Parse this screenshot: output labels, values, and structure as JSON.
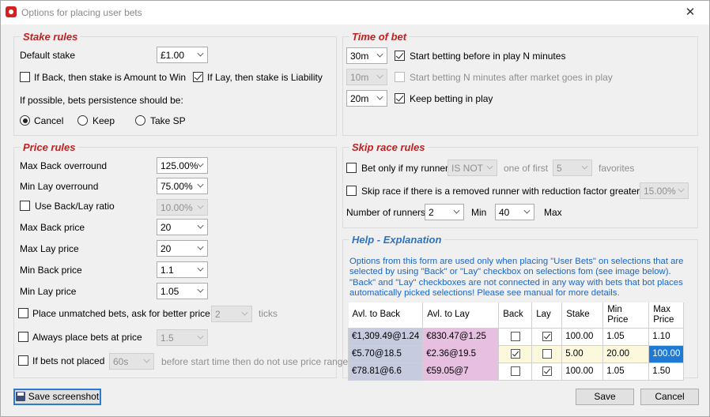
{
  "window": {
    "title": "Options for placing user bets",
    "close_glyph": "✕"
  },
  "stake_rules": {
    "legend": "Stake rules",
    "default_stake_label": "Default stake",
    "default_stake_value": "£1.00",
    "if_back_label": "If Back, then stake is Amount to Win",
    "if_back_checked": false,
    "if_lay_label": "If Lay, then stake is Liability",
    "if_lay_checked": true,
    "persistence_label": "If possible, bets persistence should be:",
    "radio_cancel": "Cancel",
    "radio_keep": "Keep",
    "radio_take_sp": "Take SP",
    "selected_persistence": "Cancel"
  },
  "time_of_bet": {
    "legend": "Time of bet",
    "row1_value": "30m",
    "row1_label": "Start betting before in play N minutes",
    "row2_value": "10m",
    "row2_label": "Start betting N minutes after market goes in play",
    "row3_value": "20m",
    "row3_label": "Keep betting in play"
  },
  "price_rules": {
    "legend": "Price rules",
    "max_back_overround_label": "Max Back overround",
    "max_back_overround_value": "125.00%",
    "min_lay_overround_label": "Min Lay overround",
    "min_lay_overround_value": "75.00%",
    "use_ratio_label": "Use Back/Lay ratio",
    "use_ratio_value": "10.00%",
    "max_back_price_label": "Max Back price",
    "max_back_price_value": "20",
    "max_lay_price_label": "Max Lay price",
    "max_lay_price_value": "20",
    "min_back_price_label": "Min Back price",
    "min_back_price_value": "1.1",
    "min_lay_price_label": "Min Lay price",
    "min_lay_price_value": "1.05",
    "unmatched_label": "Place unmatched bets, ask for better price by",
    "unmatched_value": "2",
    "ticks_label": "ticks",
    "always_label": "Always place bets at price",
    "always_value": "1.5",
    "not_placed_label": "If bets not placed",
    "not_placed_value": "60s",
    "not_placed_suffix": "before start time then do not use price range"
  },
  "skip_race": {
    "legend": "Skip race rules",
    "bet_only_label": "Bet only if my runner",
    "bet_only_value": "IS NOT",
    "one_of_first_label": "one of first",
    "one_of_first_value": "5",
    "favorites_label": "favorites",
    "removed_label": "Skip race if there is a removed runner with reduction factor greater than",
    "removed_value": "15.00%",
    "runners_label": "Number of runners",
    "runners_min_value": "2",
    "min_label": "Min",
    "runners_max_value": "40",
    "max_label": "Max"
  },
  "help": {
    "legend": "Help - Explanation",
    "text": "Options from this form are used only when placing \"User Bets\" on selections that are selected by using \"Back\" or \"Lay\" checkbox on selections fom (see image below). \"Back\" and \"Lay\" checkboxes are not connected in any way with bets that bot places automatically picked selections! Please see manual for more details.",
    "columns": [
      "Avl. to Back",
      "Avl. to Lay",
      "Back",
      "Lay",
      "Stake",
      "Min Price",
      "Max Price"
    ],
    "rows": [
      {
        "back": "€1,309.49@1.24",
        "lay": "€830.47@1.25",
        "back_checked": false,
        "lay_checked": true,
        "stake": "100.00",
        "min": "1.05",
        "max": "1.10"
      },
      {
        "back": "€5.70@18.5",
        "lay": "€2.36@19.5",
        "back_checked": true,
        "lay_checked": false,
        "stake": "5.00",
        "min": "20.00",
        "max": "100.00"
      },
      {
        "back": "€78.81@6.6",
        "lay": "€59.05@7",
        "back_checked": false,
        "lay_checked": true,
        "stake": "100.00",
        "min": "1.05",
        "max": "1.50"
      }
    ]
  },
  "buttons": {
    "save_screenshot": "Save screenshot",
    "save": "Save",
    "cancel": "Cancel"
  }
}
